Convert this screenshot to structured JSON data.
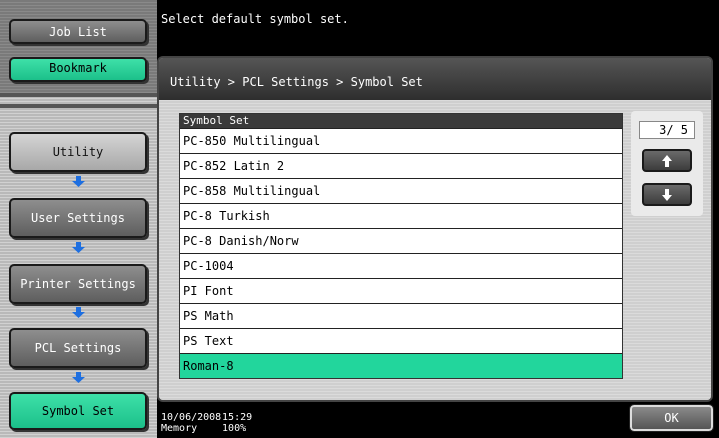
{
  "sidebar": {
    "job_list": "Job List",
    "bookmark": "Bookmark",
    "nav": [
      "Utility",
      "User Settings",
      "Printer Settings",
      "PCL Settings",
      "Symbol Set"
    ]
  },
  "header": {
    "message": "Select default symbol set."
  },
  "breadcrumb": "Utility > PCL Settings > Symbol Set",
  "list": {
    "header": "Symbol Set",
    "items": [
      "PC-850 Multilingual",
      "PC-852 Latin 2",
      "PC-858 Multilingual",
      "PC-8 Turkish",
      "PC-8 Danish/Norw",
      "PC-1004",
      "PI Font",
      "PS Math",
      "PS Text",
      "Roman-8"
    ],
    "selected_index": 9
  },
  "pager": {
    "label": "3/ 5"
  },
  "status": {
    "date": "10/06/2008",
    "time": "15:29",
    "memory_label": "Memory",
    "memory_value": "100%"
  },
  "ok_label": "OK",
  "colors": {
    "selected": "#22d69c",
    "accent_arrow": "#1e6fe0"
  },
  "icons": {
    "page_up": "arrow-up-icon",
    "page_down": "arrow-down-icon",
    "flow": "arrow-down-icon"
  }
}
